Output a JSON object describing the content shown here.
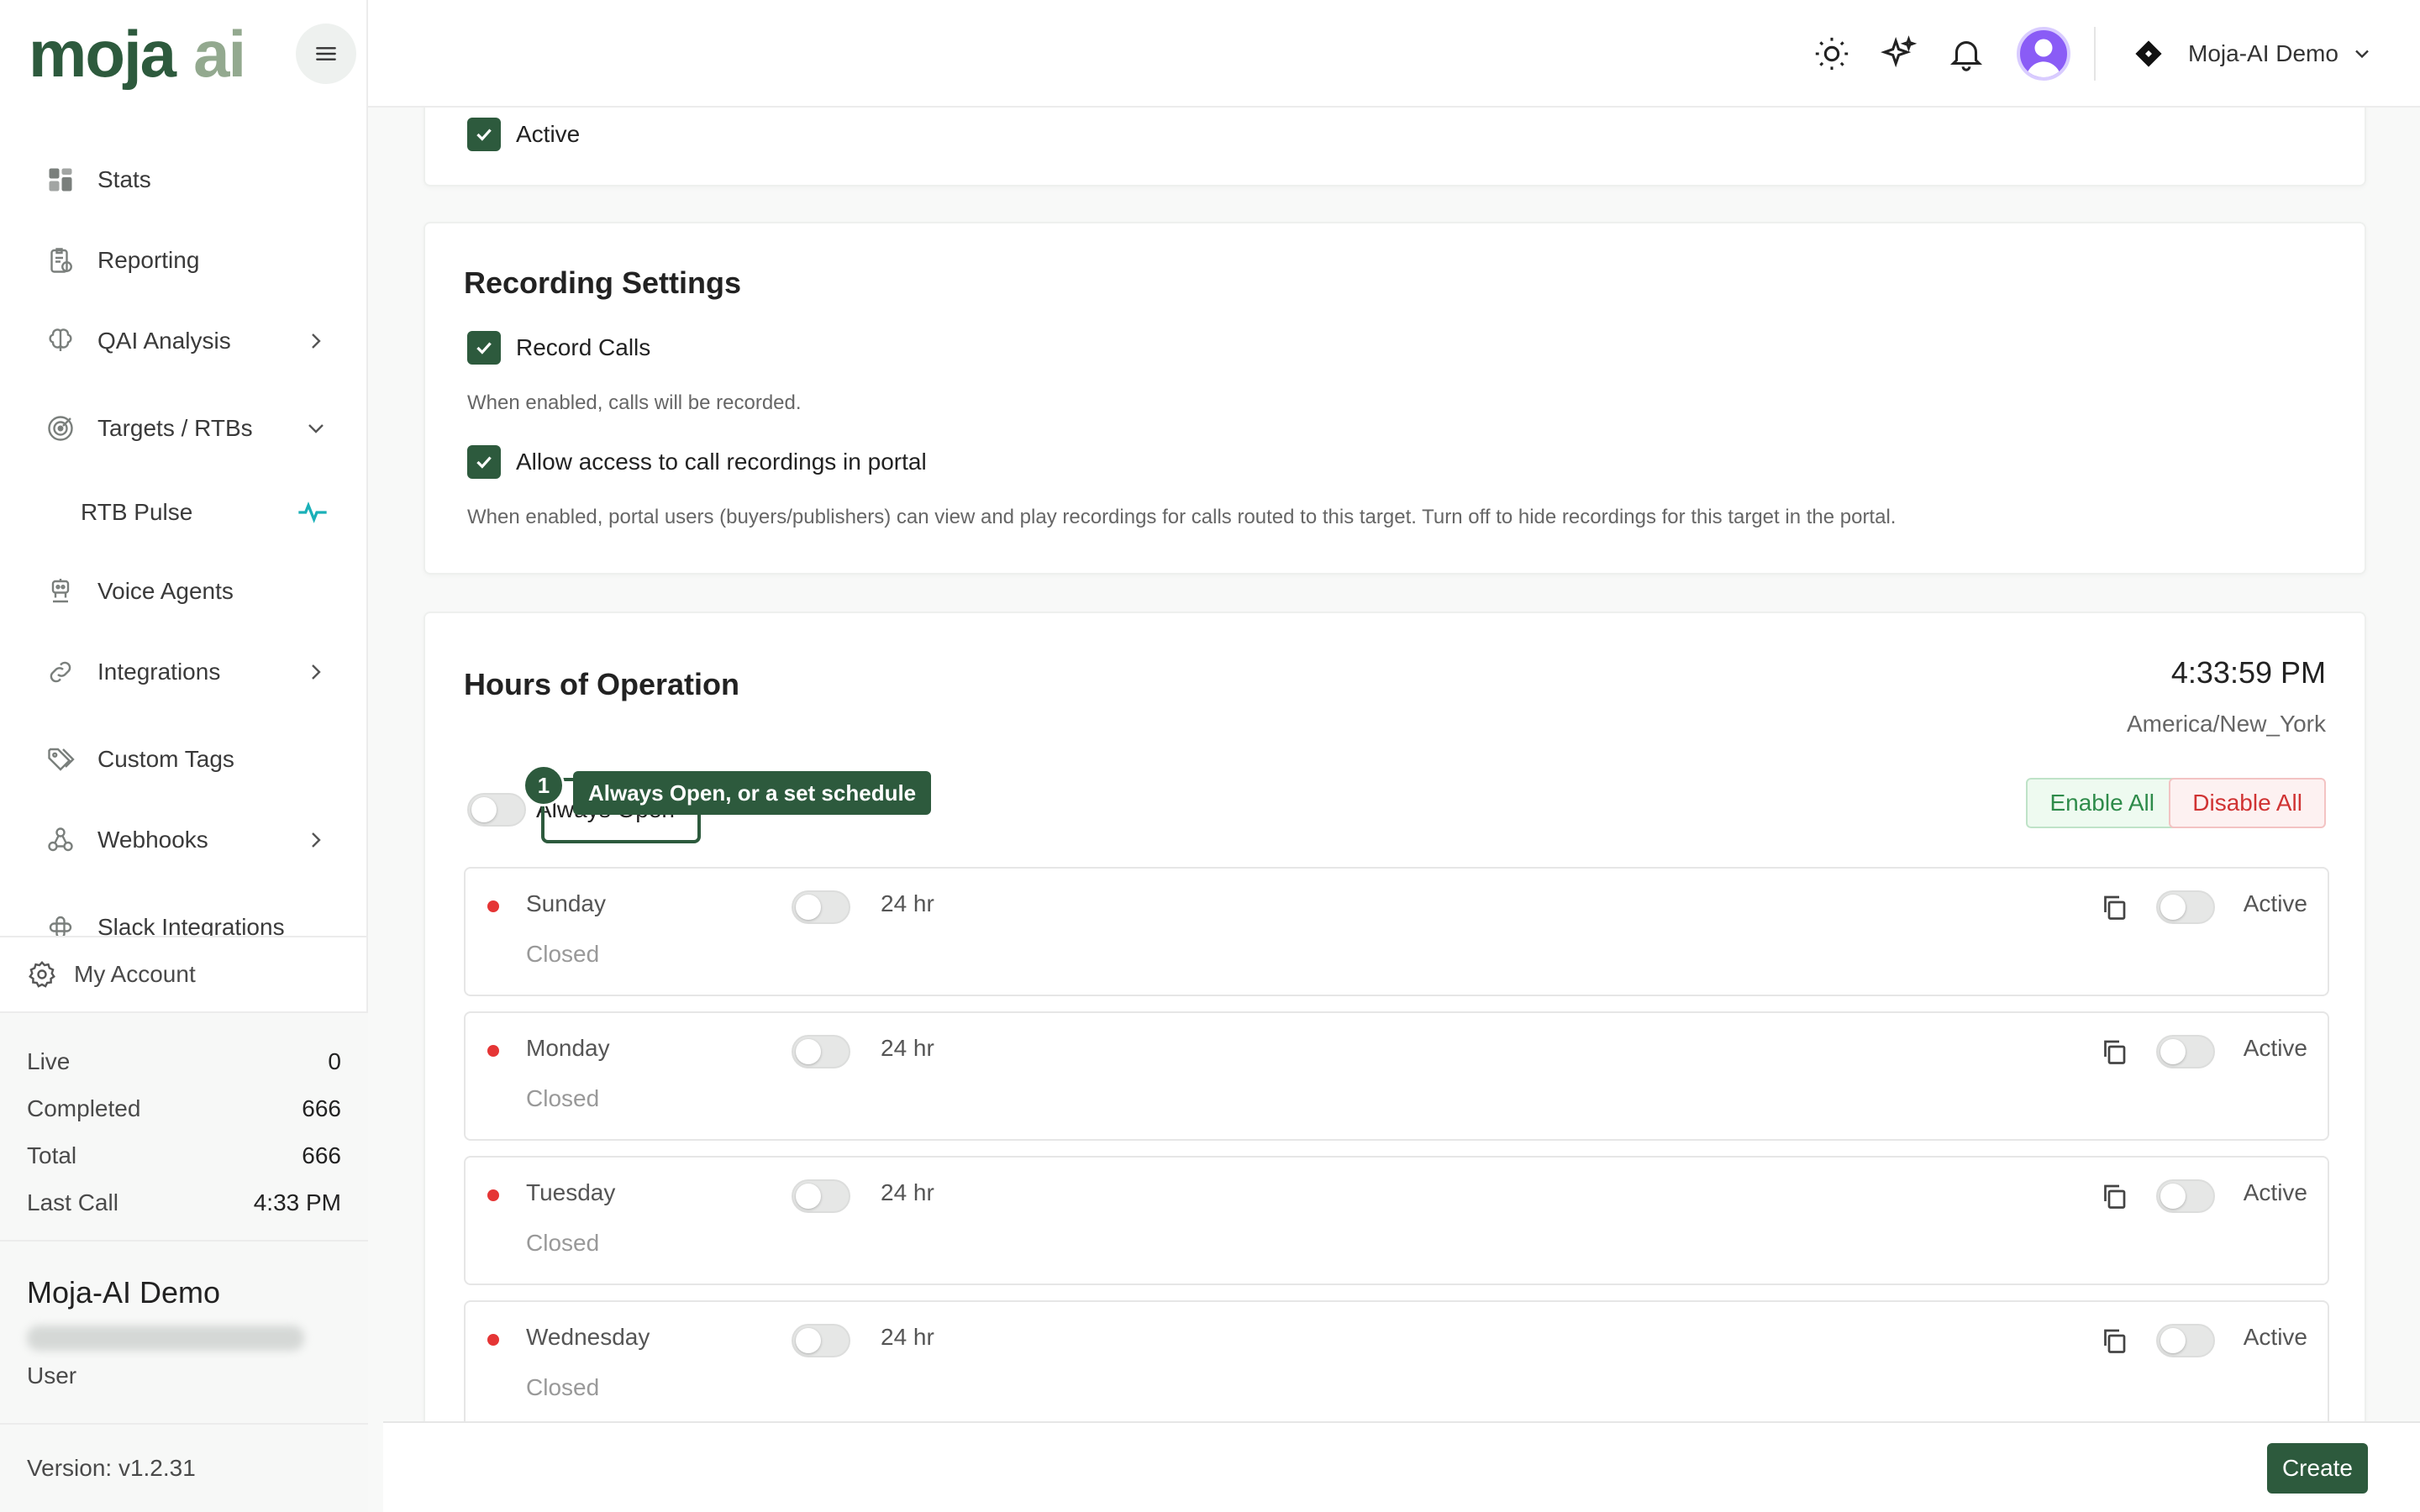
{
  "brand": {
    "logo_left": "moja",
    "logo_right": "ai"
  },
  "sidebar": {
    "items": [
      {
        "label": "Stats",
        "icon": "stats-grid-icon"
      },
      {
        "label": "Reporting",
        "icon": "reporting-icon"
      },
      {
        "label": "QAI Analysis",
        "icon": "brain-icon",
        "chevron": "right"
      },
      {
        "label": "Targets / RTBs",
        "icon": "target-icon",
        "chevron": "down"
      },
      {
        "label": "RTB Pulse",
        "icon": "pulse-icon",
        "sub": true
      },
      {
        "label": "Voice Agents",
        "icon": "robot-icon"
      },
      {
        "label": "Integrations",
        "icon": "link-icon",
        "chevron": "right"
      },
      {
        "label": "Custom Tags",
        "icon": "tags-icon"
      },
      {
        "label": "Webhooks",
        "icon": "webhook-icon",
        "chevron": "right"
      },
      {
        "label": "Slack Integrations",
        "icon": "slack-icon"
      }
    ],
    "account_label": "My Account",
    "stats": [
      {
        "label": "Live",
        "value": "0"
      },
      {
        "label": "Completed",
        "value": "666"
      },
      {
        "label": "Total",
        "value": "666"
      },
      {
        "label": "Last Call",
        "value": "4:33 PM"
      }
    ],
    "profile": {
      "name": "Moja-AI Demo",
      "role": "User"
    },
    "version": "Version: v1.2.31"
  },
  "topbar": {
    "org_name": "Moja-AI Demo"
  },
  "status_card": {
    "active_label": "Active"
  },
  "recording": {
    "title": "Recording Settings",
    "record_label": "Record Calls",
    "record_help": "When enabled, calls will be recorded.",
    "portal_label": "Allow access to call recordings in portal",
    "portal_help": "When enabled, portal users (buyers/publishers) can view and play recordings for calls routed to this target. Turn off to hide recordings for this target in the portal."
  },
  "hours": {
    "title": "Hours of Operation",
    "time": "4:33:59 PM",
    "timezone": "America/New_York",
    "always_open_label": "Always Open",
    "enable_all": "Enable All",
    "disable_all": "Disable All",
    "tour_step": "1",
    "tour_text": "Always Open, or a set schedule",
    "days": [
      {
        "name": "Sunday",
        "status": "Closed",
        "hr_label": "24 hr",
        "active_label": "Active"
      },
      {
        "name": "Monday",
        "status": "Closed",
        "hr_label": "24 hr",
        "active_label": "Active"
      },
      {
        "name": "Tuesday",
        "status": "Closed",
        "hr_label": "24 hr",
        "active_label": "Active"
      },
      {
        "name": "Wednesday",
        "status": "Closed",
        "hr_label": "24 hr",
        "active_label": "Active"
      }
    ]
  },
  "footer": {
    "create_label": "Create"
  },
  "colors": {
    "brand_green": "#2d5a3d",
    "logo_ai": "#93a98f",
    "closed_dot": "#e53535",
    "avatar": "#8a5cf6"
  }
}
